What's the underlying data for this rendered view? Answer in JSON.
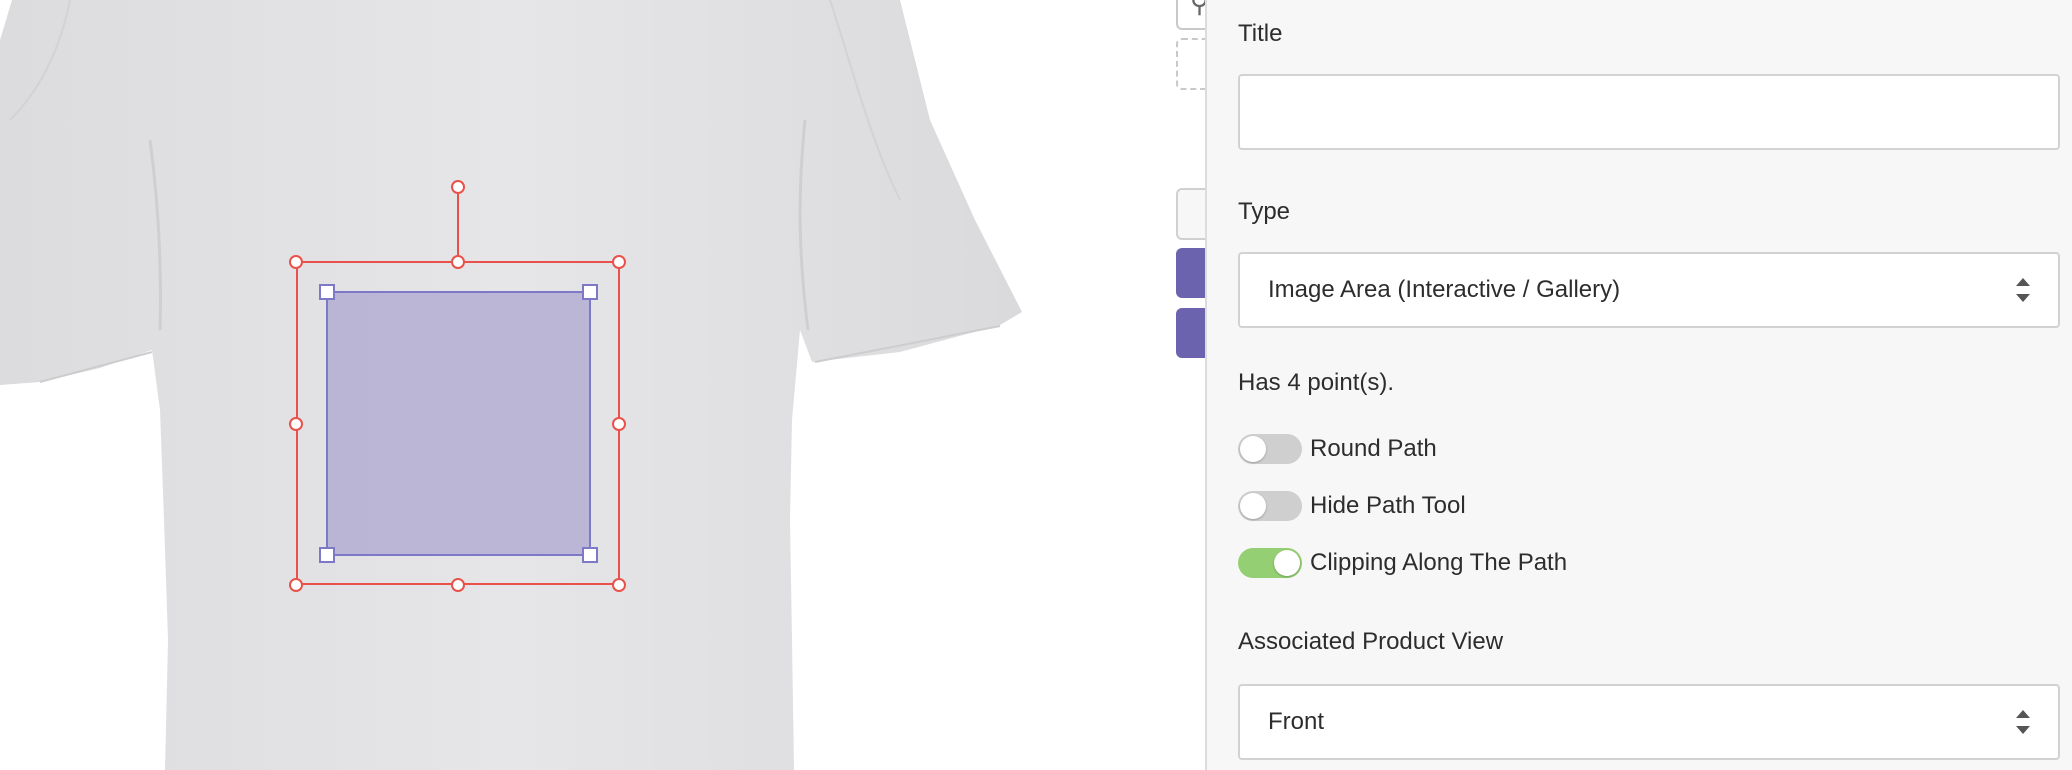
{
  "panel": {
    "title_label": "Title",
    "title_value": "",
    "type_label": "Type",
    "type_value": "Image Area (Interactive / Gallery)",
    "points_text": "Has 4 point(s).",
    "toggles": [
      {
        "label": "Round Path",
        "on": false
      },
      {
        "label": "Hide Path Tool",
        "on": false
      },
      {
        "label": "Clipping Along The Path",
        "on": true
      }
    ],
    "view_label": "Associated Product View",
    "view_value": "Front"
  },
  "icons": {
    "toolbar_search": "search-icon",
    "select_arrows": "chevron-updown-icon"
  },
  "colors": {
    "selection": "#e8524a",
    "area_fill": "#aaa4ce",
    "area_border": "#7d79c6",
    "toggle_on": "#95cf73",
    "toggle_off": "#cfcfcf",
    "accent_button": "#6b63ad"
  }
}
